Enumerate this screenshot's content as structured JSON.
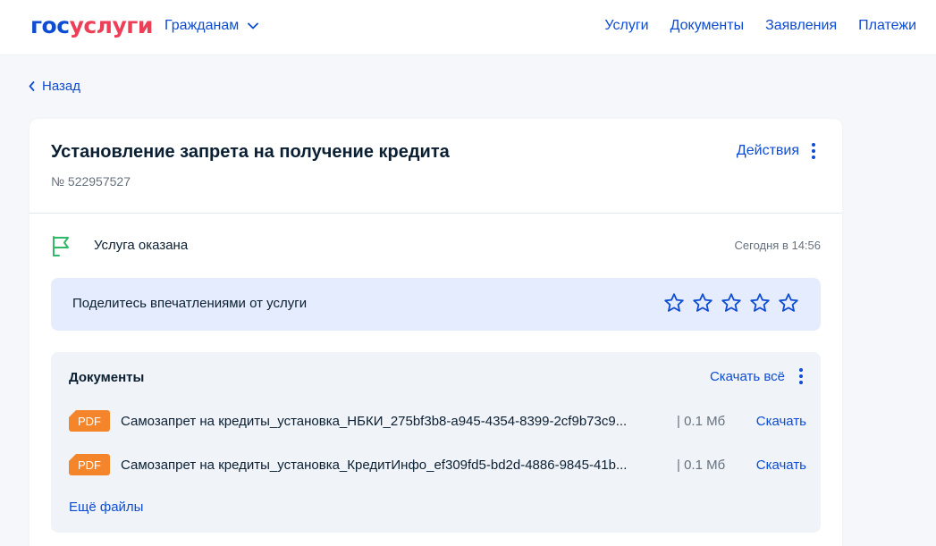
{
  "header": {
    "logo_part1": "гос",
    "logo_part2": "услуги",
    "audience_label": "Гражданам",
    "nav": [
      "Услуги",
      "Документы",
      "Заявления",
      "Платежи"
    ]
  },
  "back_label": "Назад",
  "request": {
    "title": "Установление запрета на получение кредита",
    "number": "№ 522957527",
    "actions_label": "Действия"
  },
  "status": {
    "text": "Услуга оказана",
    "time": "Сегодня в 14:56",
    "icon": "flag-icon"
  },
  "feedback": {
    "prompt": "Поделитесь впечатлениями от услуги",
    "rating_max": 5,
    "rating_value": 0
  },
  "documents": {
    "title": "Документы",
    "download_all_label": "Скачать всё",
    "files": [
      {
        "type": "PDF",
        "name": "Самозапрет на кредиты_установка_НБКИ_275bf3b8-a945-4354-8399-2cf9b73c9...",
        "size": "|  0.1 Мб",
        "download_label": "Скачать"
      },
      {
        "type": "PDF",
        "name": "Самозапрет на кредиты_установка_КредитИнфо_ef309fd5-bd2d-4886-9845-41b...",
        "size": "|  0.1 Мб",
        "download_label": "Скачать"
      }
    ],
    "more_files_label": "Ещё файлы"
  },
  "colors": {
    "brand_blue": "#0d4cd3",
    "brand_red": "#ee3f58",
    "success_green": "#2fb969",
    "pdf_orange": "#f5852a",
    "feedback_bg": "#e4ecfd",
    "docs_bg": "#f0f3f7",
    "page_bg": "#f5f7fa"
  }
}
